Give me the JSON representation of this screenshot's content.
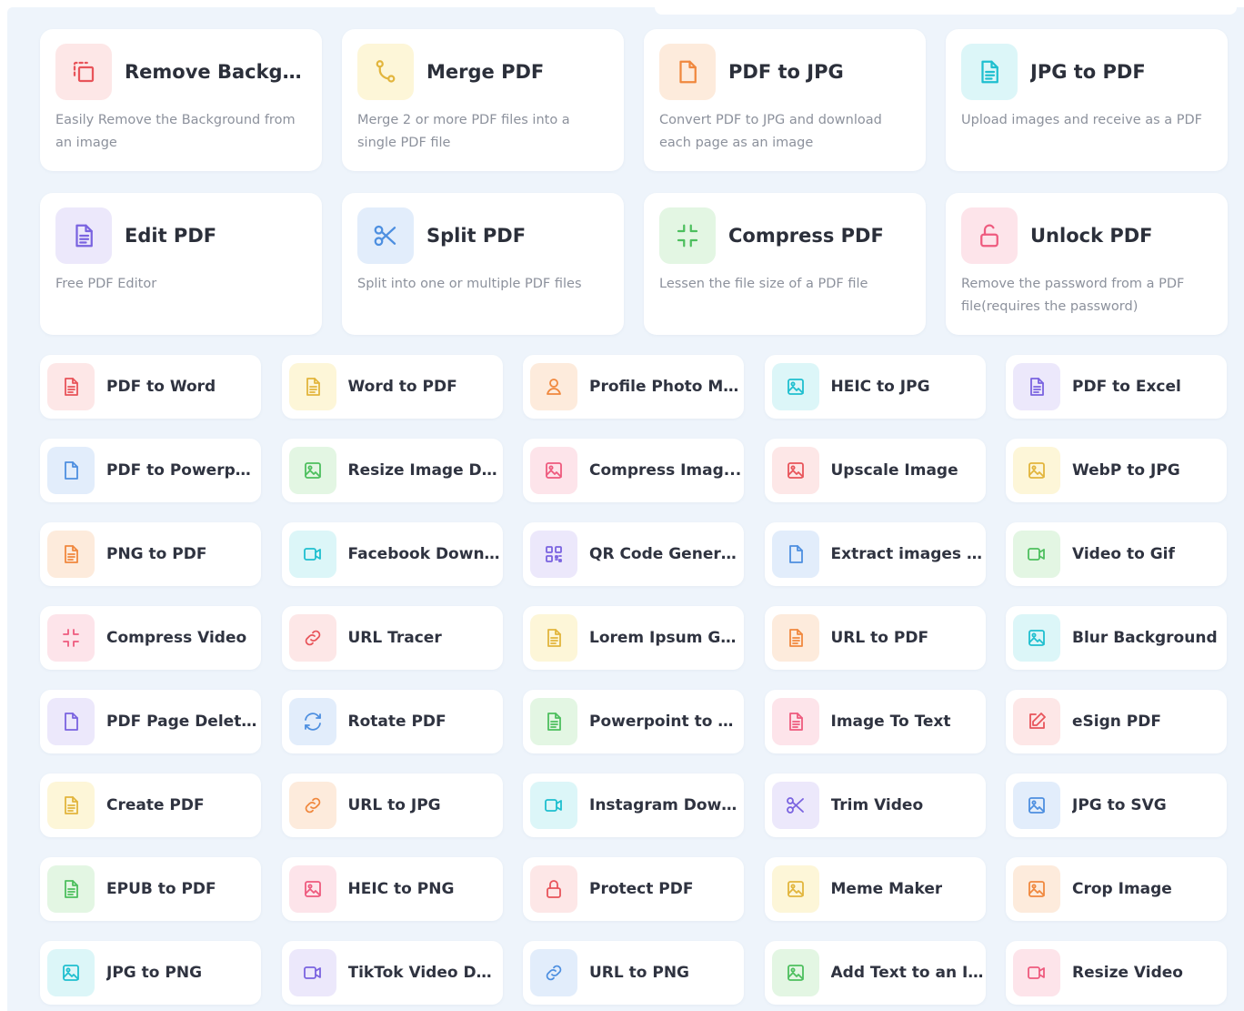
{
  "colors": {
    "red": {
      "bg": "#fde7e7",
      "fg": "#e8545a"
    },
    "yellow": {
      "bg": "#fdf6d8",
      "fg": "#e2b53c"
    },
    "orange": {
      "bg": "#fdebdc",
      "fg": "#f0883e"
    },
    "cyan": {
      "bg": "#dcf6f8",
      "fg": "#1fbfcf"
    },
    "purple": {
      "bg": "#ece8fb",
      "fg": "#7a63e0"
    },
    "blue": {
      "bg": "#e2edfb",
      "fg": "#4d8fe0"
    },
    "green": {
      "bg": "#e3f6e3",
      "fg": "#4dbf5e"
    },
    "pink": {
      "bg": "#fde4ea",
      "fg": "#ee5a7e"
    }
  },
  "featured": [
    {
      "title": "Remove Backgr...",
      "desc": "Easily Remove the Background from an image",
      "icon": "crop-bg-icon",
      "color": "red"
    },
    {
      "title": "Merge PDF",
      "desc": "Merge 2 or more PDF files into a single PDF file",
      "icon": "merge-icon",
      "color": "yellow"
    },
    {
      "title": "PDF to JPG",
      "desc": "Convert PDF to JPG and download each page as an image",
      "icon": "file-icon",
      "color": "orange"
    },
    {
      "title": "JPG to PDF",
      "desc": "Upload images and receive as a PDF",
      "icon": "doc-icon",
      "color": "cyan"
    },
    {
      "title": "Edit PDF",
      "desc": "Free PDF Editor",
      "icon": "doc-icon",
      "color": "purple"
    },
    {
      "title": "Split PDF",
      "desc": "Split into one or multiple PDF files",
      "icon": "scissors-icon",
      "color": "blue"
    },
    {
      "title": "Compress PDF",
      "desc": "Lessen the file size of a PDF file",
      "icon": "compress-icon",
      "color": "green"
    },
    {
      "title": "Unlock PDF",
      "desc": "Remove the password from a PDF file(requires the password)",
      "icon": "unlock-icon",
      "color": "pink"
    }
  ],
  "tools": [
    {
      "label": "PDF to Word",
      "icon": "doc-icon",
      "color": "red"
    },
    {
      "label": "Word to PDF",
      "icon": "doc-icon",
      "color": "yellow"
    },
    {
      "label": "Profile Photo Ma...",
      "icon": "user-icon",
      "color": "orange"
    },
    {
      "label": "HEIC to JPG",
      "icon": "image-icon",
      "color": "cyan"
    },
    {
      "label": "PDF to Excel",
      "icon": "doc-icon",
      "color": "purple"
    },
    {
      "label": "PDF to Powerpoint",
      "icon": "file-icon",
      "color": "blue"
    },
    {
      "label": "Resize Image Di...",
      "icon": "image-icon",
      "color": "green"
    },
    {
      "label": "Compress Imag...",
      "icon": "image-icon",
      "color": "pink"
    },
    {
      "label": "Upscale Image",
      "icon": "image-icon",
      "color": "red"
    },
    {
      "label": "WebP to JPG",
      "icon": "image-icon",
      "color": "yellow"
    },
    {
      "label": "PNG to PDF",
      "icon": "doc-icon",
      "color": "orange"
    },
    {
      "label": "Facebook Downl...",
      "icon": "video-icon",
      "color": "cyan"
    },
    {
      "label": "QR Code Genera...",
      "icon": "qr-icon",
      "color": "purple"
    },
    {
      "label": "Extract images P...",
      "icon": "file-icon",
      "color": "blue"
    },
    {
      "label": "Video to Gif",
      "icon": "video-icon",
      "color": "green"
    },
    {
      "label": "Compress Video",
      "icon": "compress-icon",
      "color": "pink"
    },
    {
      "label": "URL Tracer",
      "icon": "link-icon",
      "color": "red"
    },
    {
      "label": "Lorem Ipsum Ge...",
      "icon": "doc-icon",
      "color": "yellow"
    },
    {
      "label": "URL to PDF",
      "icon": "doc-icon",
      "color": "orange"
    },
    {
      "label": "Blur Background",
      "icon": "image-icon",
      "color": "cyan"
    },
    {
      "label": "PDF Page Deleter",
      "icon": "file-icon",
      "color": "purple"
    },
    {
      "label": "Rotate PDF",
      "icon": "rotate-icon",
      "color": "blue"
    },
    {
      "label": "Powerpoint to PDF",
      "icon": "doc-icon",
      "color": "green"
    },
    {
      "label": "Image To Text",
      "icon": "doc-icon",
      "color": "pink"
    },
    {
      "label": "eSign PDF",
      "icon": "edit-icon",
      "color": "red"
    },
    {
      "label": "Create PDF",
      "icon": "doc-icon",
      "color": "yellow"
    },
    {
      "label": "URL to JPG",
      "icon": "link-icon",
      "color": "orange"
    },
    {
      "label": "Instagram Down...",
      "icon": "video-icon",
      "color": "cyan"
    },
    {
      "label": "Trim Video",
      "icon": "scissors-icon",
      "color": "purple"
    },
    {
      "label": "JPG to SVG",
      "icon": "image-icon",
      "color": "blue"
    },
    {
      "label": "EPUB to PDF",
      "icon": "doc-icon",
      "color": "green"
    },
    {
      "label": "HEIC to PNG",
      "icon": "image-icon",
      "color": "pink"
    },
    {
      "label": "Protect PDF",
      "icon": "lock-icon",
      "color": "red"
    },
    {
      "label": "Meme Maker",
      "icon": "image-icon",
      "color": "yellow"
    },
    {
      "label": "Crop Image",
      "icon": "image-icon",
      "color": "orange"
    },
    {
      "label": "JPG to PNG",
      "icon": "image-icon",
      "color": "cyan"
    },
    {
      "label": "TikTok Video Do...",
      "icon": "video-icon",
      "color": "purple"
    },
    {
      "label": "URL to PNG",
      "icon": "link-icon",
      "color": "blue"
    },
    {
      "label": "Add Text to an I...",
      "icon": "image-icon",
      "color": "green"
    },
    {
      "label": "Resize Video",
      "icon": "video-icon",
      "color": "pink"
    }
  ]
}
